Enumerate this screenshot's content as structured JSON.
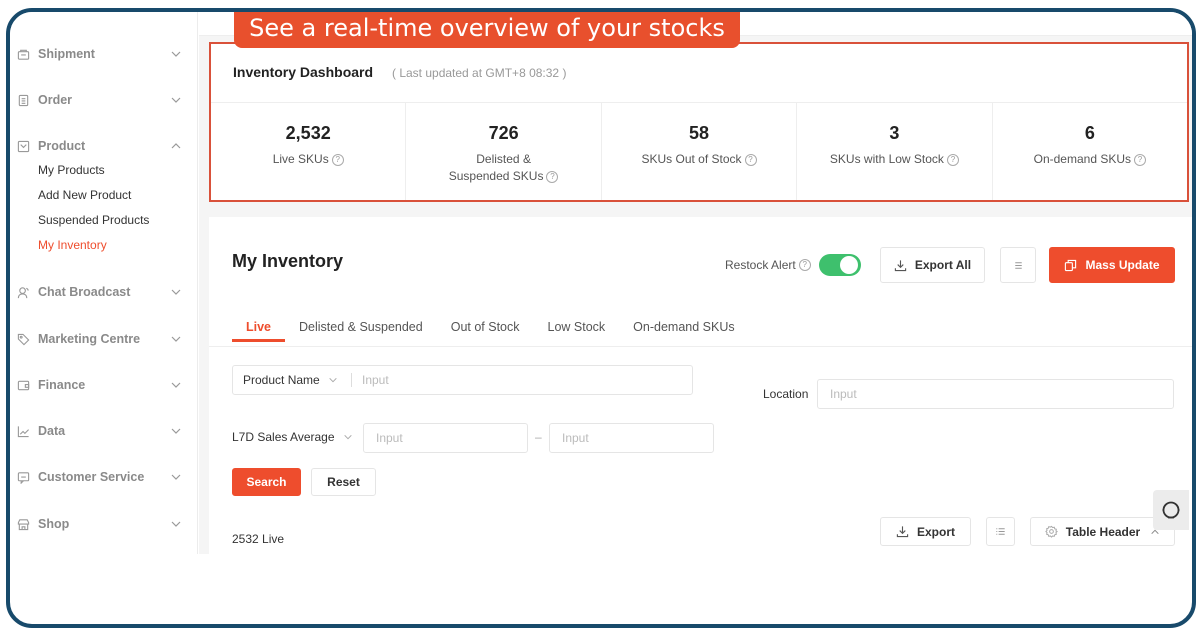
{
  "banner": {
    "text": "See a real-time overview of your stocks"
  },
  "sidebar": {
    "groups": [
      {
        "label": "Shipment",
        "icon": "shipment-icon",
        "expanded": false
      },
      {
        "label": "Order",
        "icon": "order-icon",
        "expanded": false
      },
      {
        "label": "Product",
        "icon": "product-icon",
        "expanded": true,
        "items": [
          {
            "label": "My Products",
            "active": false
          },
          {
            "label": "Add New Product",
            "active": false
          },
          {
            "label": "Suspended Products",
            "active": false
          },
          {
            "label": "My Inventory",
            "active": true
          }
        ]
      },
      {
        "label": "Chat Broadcast",
        "icon": "chat-broadcast-icon",
        "expanded": false
      },
      {
        "label": "Marketing Centre",
        "icon": "tag-icon",
        "expanded": false
      },
      {
        "label": "Finance",
        "icon": "wallet-icon",
        "expanded": false
      },
      {
        "label": "Data",
        "icon": "chart-line-icon",
        "expanded": false
      },
      {
        "label": "Customer Service",
        "icon": "customer-service-icon",
        "expanded": false
      },
      {
        "label": "Shop",
        "icon": "shop-icon",
        "expanded": false
      }
    ]
  },
  "dashboard": {
    "title": "Inventory Dashboard",
    "last_updated": "( Last updated at GMT+8 08:32 )",
    "stats": [
      {
        "value": "2,532",
        "label": "Live SKUs"
      },
      {
        "value": "726",
        "label": "Delisted & Suspended SKUs"
      },
      {
        "value": "58",
        "label": "SKUs Out of Stock"
      },
      {
        "value": "3",
        "label": "SKUs with Low Stock"
      },
      {
        "value": "6",
        "label": "On-demand SKUs"
      }
    ]
  },
  "inventory": {
    "title": "My Inventory",
    "restock_alert_label": "Restock Alert",
    "restock_alert_on": true,
    "export_all_label": "Export All",
    "mass_update_label": "Mass Update",
    "tabs": [
      {
        "label": "Live",
        "active": true
      },
      {
        "label": "Delisted & Suspended",
        "active": false
      },
      {
        "label": "Out of Stock",
        "active": false
      },
      {
        "label": "Low Stock",
        "active": false
      },
      {
        "label": "On-demand SKUs",
        "active": false
      }
    ],
    "filters": {
      "product_select": "Product Name",
      "product_placeholder": "Input",
      "location_label": "Location",
      "location_placeholder": "Input",
      "sales_select": "L7D Sales Average",
      "sales_min_placeholder": "Input",
      "range_separator": "–",
      "sales_max_placeholder": "Input",
      "search_label": "Search",
      "reset_label": "Reset"
    },
    "count_text": "2532 Live",
    "export_label": "Export",
    "table_header_label": "Table Header"
  },
  "colors": {
    "accent": "#ee4d2d",
    "frame": "#184a6b",
    "toggle_on": "#3ec06d",
    "highlight_border": "#d9513a"
  }
}
